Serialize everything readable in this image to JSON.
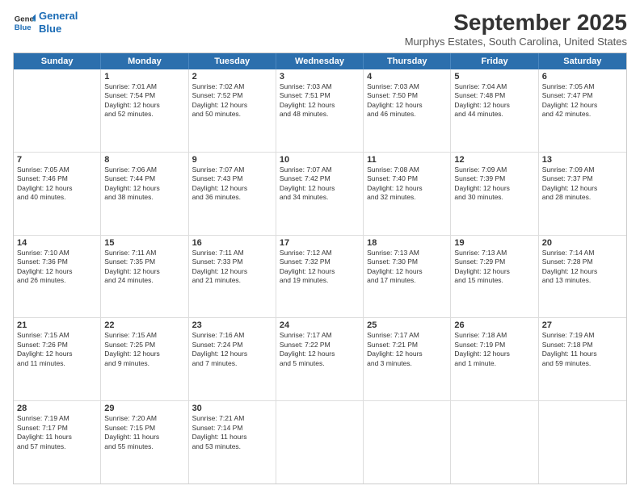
{
  "logo": {
    "line1": "General",
    "line2": "Blue"
  },
  "title": "September 2025",
  "location": "Murphys Estates, South Carolina, United States",
  "header_days": [
    "Sunday",
    "Monday",
    "Tuesday",
    "Wednesday",
    "Thursday",
    "Friday",
    "Saturday"
  ],
  "weeks": [
    [
      {
        "day": "",
        "text": ""
      },
      {
        "day": "1",
        "text": "Sunrise: 7:01 AM\nSunset: 7:54 PM\nDaylight: 12 hours\nand 52 minutes."
      },
      {
        "day": "2",
        "text": "Sunrise: 7:02 AM\nSunset: 7:52 PM\nDaylight: 12 hours\nand 50 minutes."
      },
      {
        "day": "3",
        "text": "Sunrise: 7:03 AM\nSunset: 7:51 PM\nDaylight: 12 hours\nand 48 minutes."
      },
      {
        "day": "4",
        "text": "Sunrise: 7:03 AM\nSunset: 7:50 PM\nDaylight: 12 hours\nand 46 minutes."
      },
      {
        "day": "5",
        "text": "Sunrise: 7:04 AM\nSunset: 7:48 PM\nDaylight: 12 hours\nand 44 minutes."
      },
      {
        "day": "6",
        "text": "Sunrise: 7:05 AM\nSunset: 7:47 PM\nDaylight: 12 hours\nand 42 minutes."
      }
    ],
    [
      {
        "day": "7",
        "text": "Sunrise: 7:05 AM\nSunset: 7:46 PM\nDaylight: 12 hours\nand 40 minutes."
      },
      {
        "day": "8",
        "text": "Sunrise: 7:06 AM\nSunset: 7:44 PM\nDaylight: 12 hours\nand 38 minutes."
      },
      {
        "day": "9",
        "text": "Sunrise: 7:07 AM\nSunset: 7:43 PM\nDaylight: 12 hours\nand 36 minutes."
      },
      {
        "day": "10",
        "text": "Sunrise: 7:07 AM\nSunset: 7:42 PM\nDaylight: 12 hours\nand 34 minutes."
      },
      {
        "day": "11",
        "text": "Sunrise: 7:08 AM\nSunset: 7:40 PM\nDaylight: 12 hours\nand 32 minutes."
      },
      {
        "day": "12",
        "text": "Sunrise: 7:09 AM\nSunset: 7:39 PM\nDaylight: 12 hours\nand 30 minutes."
      },
      {
        "day": "13",
        "text": "Sunrise: 7:09 AM\nSunset: 7:37 PM\nDaylight: 12 hours\nand 28 minutes."
      }
    ],
    [
      {
        "day": "14",
        "text": "Sunrise: 7:10 AM\nSunset: 7:36 PM\nDaylight: 12 hours\nand 26 minutes."
      },
      {
        "day": "15",
        "text": "Sunrise: 7:11 AM\nSunset: 7:35 PM\nDaylight: 12 hours\nand 24 minutes."
      },
      {
        "day": "16",
        "text": "Sunrise: 7:11 AM\nSunset: 7:33 PM\nDaylight: 12 hours\nand 21 minutes."
      },
      {
        "day": "17",
        "text": "Sunrise: 7:12 AM\nSunset: 7:32 PM\nDaylight: 12 hours\nand 19 minutes."
      },
      {
        "day": "18",
        "text": "Sunrise: 7:13 AM\nSunset: 7:30 PM\nDaylight: 12 hours\nand 17 minutes."
      },
      {
        "day": "19",
        "text": "Sunrise: 7:13 AM\nSunset: 7:29 PM\nDaylight: 12 hours\nand 15 minutes."
      },
      {
        "day": "20",
        "text": "Sunrise: 7:14 AM\nSunset: 7:28 PM\nDaylight: 12 hours\nand 13 minutes."
      }
    ],
    [
      {
        "day": "21",
        "text": "Sunrise: 7:15 AM\nSunset: 7:26 PM\nDaylight: 12 hours\nand 11 minutes."
      },
      {
        "day": "22",
        "text": "Sunrise: 7:15 AM\nSunset: 7:25 PM\nDaylight: 12 hours\nand 9 minutes."
      },
      {
        "day": "23",
        "text": "Sunrise: 7:16 AM\nSunset: 7:24 PM\nDaylight: 12 hours\nand 7 minutes."
      },
      {
        "day": "24",
        "text": "Sunrise: 7:17 AM\nSunset: 7:22 PM\nDaylight: 12 hours\nand 5 minutes."
      },
      {
        "day": "25",
        "text": "Sunrise: 7:17 AM\nSunset: 7:21 PM\nDaylight: 12 hours\nand 3 minutes."
      },
      {
        "day": "26",
        "text": "Sunrise: 7:18 AM\nSunset: 7:19 PM\nDaylight: 12 hours\nand 1 minute."
      },
      {
        "day": "27",
        "text": "Sunrise: 7:19 AM\nSunset: 7:18 PM\nDaylight: 11 hours\nand 59 minutes."
      }
    ],
    [
      {
        "day": "28",
        "text": "Sunrise: 7:19 AM\nSunset: 7:17 PM\nDaylight: 11 hours\nand 57 minutes."
      },
      {
        "day": "29",
        "text": "Sunrise: 7:20 AM\nSunset: 7:15 PM\nDaylight: 11 hours\nand 55 minutes."
      },
      {
        "day": "30",
        "text": "Sunrise: 7:21 AM\nSunset: 7:14 PM\nDaylight: 11 hours\nand 53 minutes."
      },
      {
        "day": "",
        "text": ""
      },
      {
        "day": "",
        "text": ""
      },
      {
        "day": "",
        "text": ""
      },
      {
        "day": "",
        "text": ""
      }
    ]
  ]
}
